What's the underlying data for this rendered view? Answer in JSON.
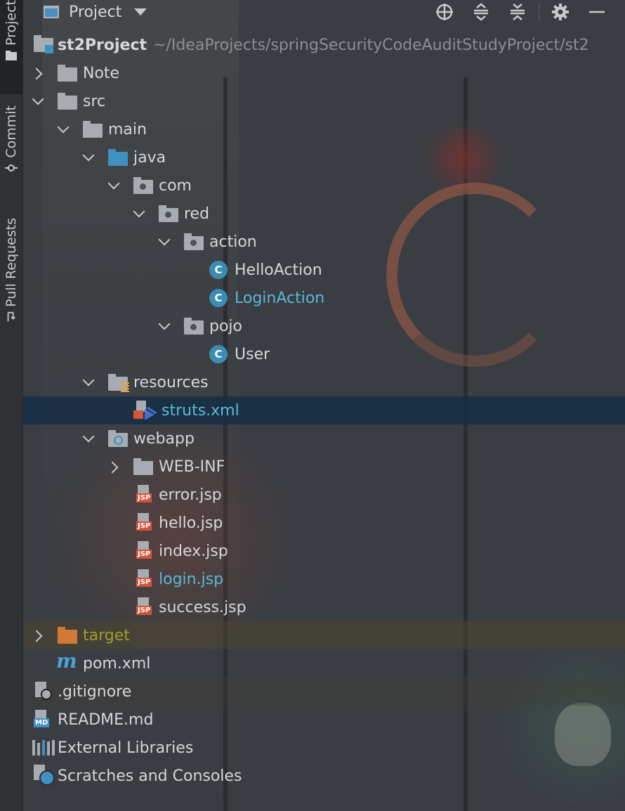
{
  "sidebar": {
    "tabs": [
      {
        "label": "Project",
        "active": true
      },
      {
        "label": "Commit",
        "active": false
      },
      {
        "label": "Pull Requests",
        "active": false
      }
    ]
  },
  "header": {
    "title": "Project",
    "tools": [
      "locate-icon",
      "expand-all-icon",
      "collapse-all-icon",
      "gear-icon",
      "minimize-icon"
    ]
  },
  "tree": {
    "root": {
      "name": "st2Project",
      "path": "~/IdeaProjects/springSecurityCodeAuditStudyProject/st2"
    },
    "note": "Note",
    "src": "src",
    "main": "main",
    "java": "java",
    "com": "com",
    "red": "red",
    "action": "action",
    "hello_action": "HelloAction",
    "login_action": "LoginAction",
    "pojo": "pojo",
    "user": "User",
    "resources": "resources",
    "struts_xml": "struts.xml",
    "webapp": "webapp",
    "web_inf": "WEB-INF",
    "error_jsp": "error.jsp",
    "hello_jsp": "hello.jsp",
    "index_jsp": "index.jsp",
    "login_jsp": "login.jsp",
    "success_jsp": "success.jsp",
    "target": "target",
    "pom_xml": "pom.xml",
    "gitignore": ".gitignore",
    "readme": "README.md",
    "external_libraries": "External Libraries",
    "scratches": "Scratches and Consoles"
  },
  "icons": {
    "class_letter": "C",
    "jsp_badge": "JSP",
    "md_badge": "MD",
    "maven_letter": "m"
  },
  "colors": {
    "selection": "#142d46",
    "modified_blue": "#5ab8d6",
    "excluded_olive": "#a39e2a"
  }
}
